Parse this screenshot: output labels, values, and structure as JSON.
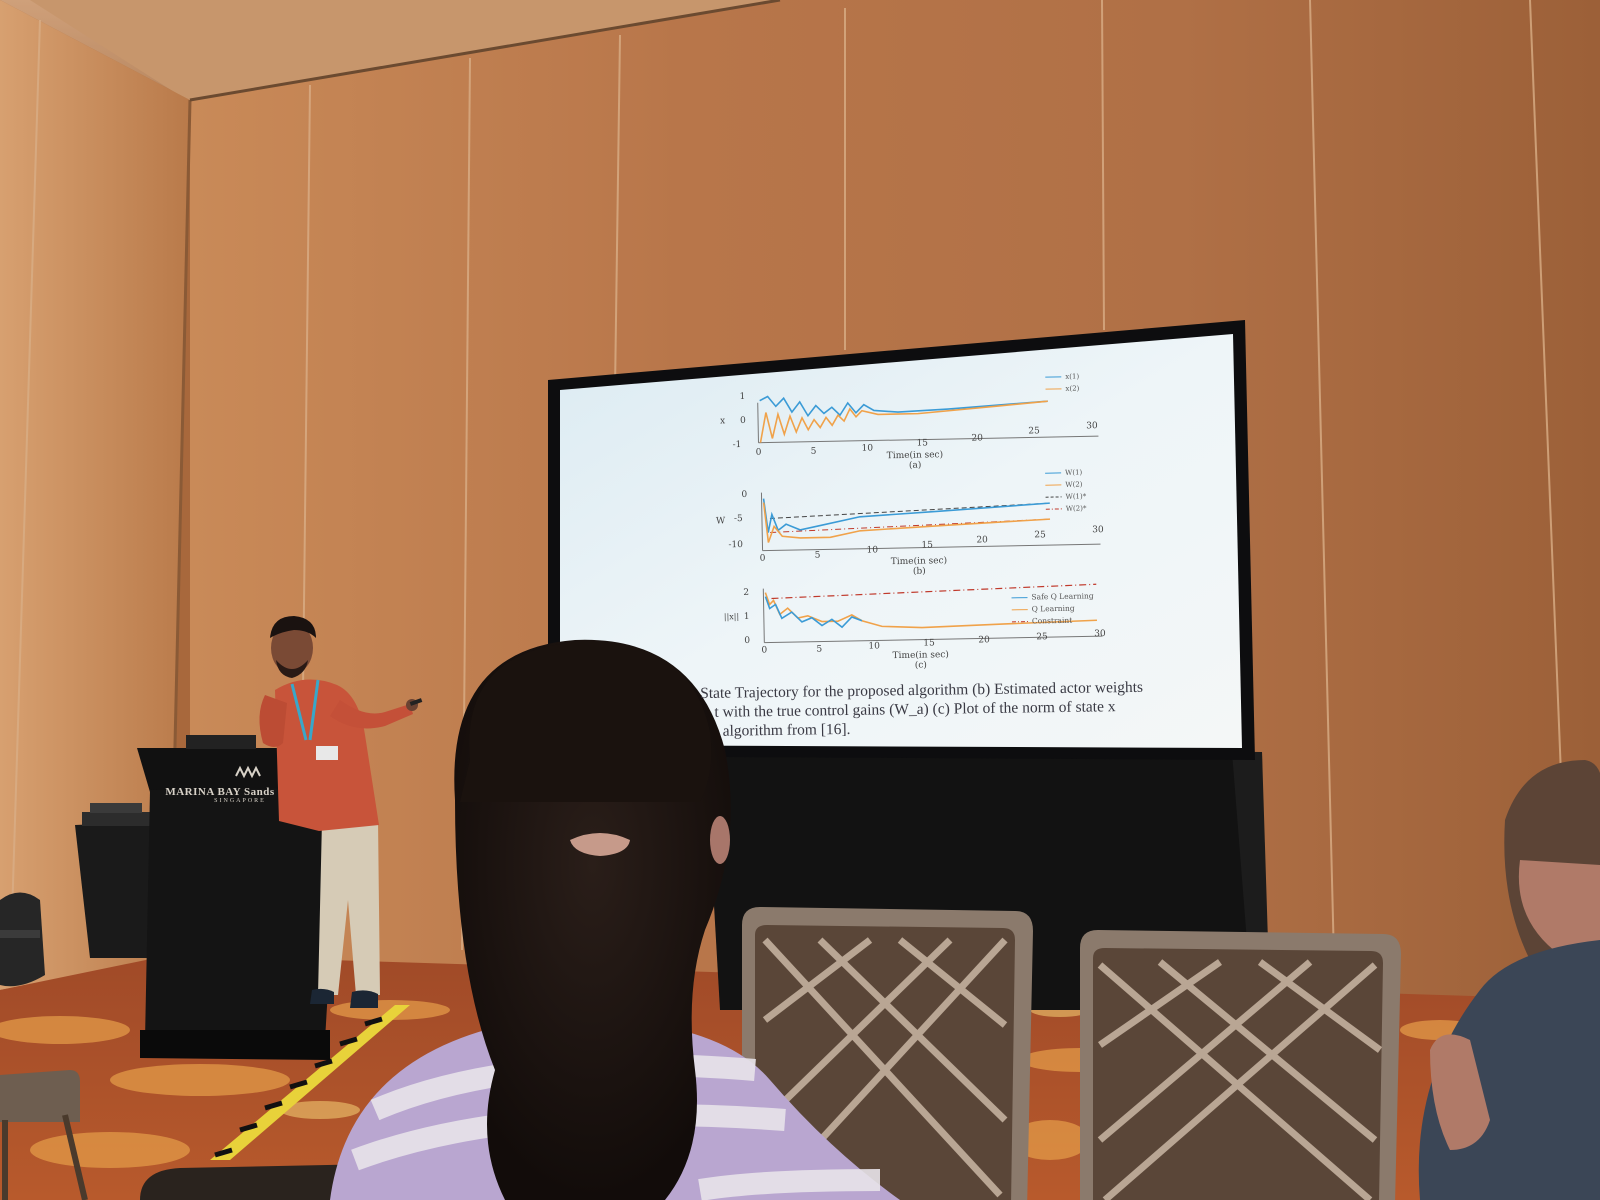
{
  "slide": {
    "panel_a": {
      "yticks": [
        "1",
        "0",
        "-1"
      ],
      "ylabel": "x",
      "xticks": [
        "0",
        "5",
        "10",
        "15",
        "20",
        "25",
        "30"
      ],
      "xlabel": "Time(in sec)",
      "sublabel": "(a)",
      "legend": [
        "x(1)",
        "x(2)"
      ]
    },
    "panel_b": {
      "yticks": [
        "0",
        "-5",
        "-10"
      ],
      "ylabel": "W",
      "xticks": [
        "0",
        "5",
        "10",
        "15",
        "20",
        "25",
        "30"
      ],
      "xlabel": "Time(in sec)",
      "sublabel": "(b)",
      "legend": [
        "W(1)",
        "W(2)",
        "W(1)*",
        "W(2)*"
      ]
    },
    "panel_c": {
      "yticks": [
        "2",
        "1",
        "0"
      ],
      "ylabel": "||x||",
      "xticks": [
        "0",
        "5",
        "10",
        "15",
        "20",
        "25",
        "30"
      ],
      "xlabel": "Time(in sec)",
      "sublabel": "(c)",
      "legend": [
        "Safe Q Learning",
        "Q Learning",
        "Constraint"
      ]
    },
    "caption_lines": [
      "State Trajectory for the proposed algorithm (b) Estimated actor weights",
      "t with the true control gains (W_a) (c) Plot of the norm of state x",
      "algorithm from [16]."
    ],
    "series_colors": {
      "blue": "#3b9bd6",
      "orange": "#f0a24a",
      "constraint": "#c0392b",
      "dark": "#444444"
    }
  },
  "podium": {
    "brand_line": "MARINA BAY Sands",
    "location": "SINGAPORE"
  }
}
